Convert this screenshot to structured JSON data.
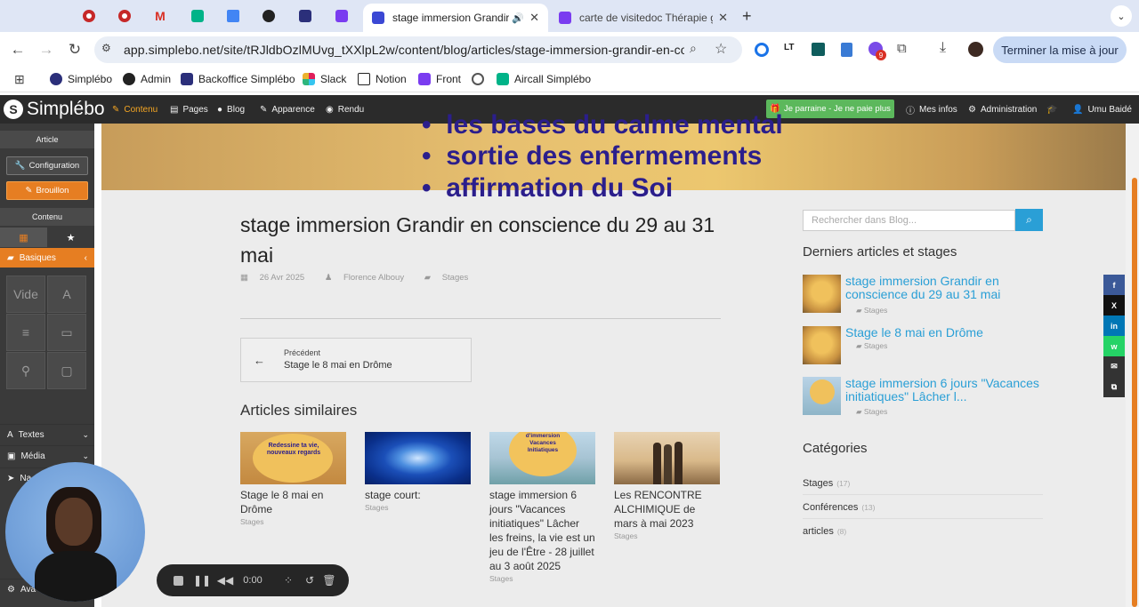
{
  "browser": {
    "tabs": [
      {
        "label": "stage immersion Grandir e",
        "active": true,
        "icon": "simplebo-tab-icon",
        "color": "#3b48d4"
      },
      {
        "label": "carte de visitedoc Thérapie g",
        "active": false,
        "icon": "form-tab-icon",
        "color": "#7a3cf0"
      }
    ],
    "url": "app.simplebo.net/site/tRJldbOzlMUvg_tXXlpL2w/content/blog/articles/stage-immersion-grandir-en-cons...",
    "update_button": "Terminer la mise à jour",
    "extension_badge": "9"
  },
  "bookmarks": [
    {
      "label": "Simplébo",
      "icon": "simplebo-icon"
    },
    {
      "label": "Admin",
      "icon": "admin-icon"
    },
    {
      "label": "Backoffice Simplébo",
      "icon": "backoffice-icon"
    },
    {
      "label": "Slack",
      "icon": "slack-icon"
    },
    {
      "label": "Notion",
      "icon": "notion-icon"
    },
    {
      "label": "Front",
      "icon": "front-icon"
    },
    {
      "label": "",
      "icon": "globe-icon"
    },
    {
      "label": "Aircall Simplébo",
      "icon": "aircall-icon"
    }
  ],
  "toolbar": {
    "logo": "Simplébo",
    "items": [
      "Contenu",
      "Pages",
      "Blog",
      "Apparence",
      "Rendu"
    ],
    "parrain": "Je parraine - Je ne paie plus",
    "right": [
      "Mes infos",
      "Administration",
      "Umu Baidé"
    ]
  },
  "leftpanel": {
    "article_header": "Article",
    "config_button": "Configuration",
    "draft_button": "Brouillon",
    "content_header": "Contenu",
    "basiques": "Basiques",
    "vide": "Vide",
    "textes": "Textes",
    "media": "Média",
    "truncated_rows": [
      "Na",
      "Ava"
    ]
  },
  "hero": {
    "lines": [
      "les bases du calme mental",
      "sortie des enfermements",
      "affirmation du Soi"
    ]
  },
  "post": {
    "title": "stage immersion Grandir en conscience du 29 au 31 mai",
    "date": "26 Avr 2025",
    "author": "Florence Albouy",
    "category": "Stages",
    "prev_label": "Précédent",
    "prev_title": "Stage le 8 mai en Drôme",
    "similar_heading": "Articles similaires",
    "similar": [
      {
        "title": "Stage le 8 mai en Drôme",
        "cat": "Stages",
        "thumb_text": "Redessine ta vie, nouveaux regards"
      },
      {
        "title": "stage court:",
        "cat": "Stages",
        "thumb_text": ""
      },
      {
        "title": "stage immersion 6 jours \"Vacances initiatiques\" Lâcher les freins, la vie est un jeu de l'Être - 28 juillet au 3 août 2025",
        "cat": "Stages",
        "thumb_text": "d'immersion Vacances Initiatiques"
      },
      {
        "title": "Les RENCONTRE ALCHIMIQUE de mars à mai 2023",
        "cat": "Stages",
        "thumb_text": ""
      }
    ]
  },
  "sidebar": {
    "search_placeholder": "Rechercher dans Blog...",
    "recent_heading": "Derniers articles et stages",
    "recent": [
      {
        "title": "stage immersion Grandir en conscience du 29 au 31 mai",
        "cat": "Stages"
      },
      {
        "title": "Stage le 8 mai en Drôme",
        "cat": "Stages"
      },
      {
        "title": "stage immersion 6 jours \"Vacances initiatiques\" Lâcher l...",
        "cat": "Stages"
      }
    ],
    "categories_heading": "Catégories",
    "categories": [
      {
        "name": "Stages",
        "count": "(17)"
      },
      {
        "name": "Conférences",
        "count": "(13)"
      },
      {
        "name": "articles",
        "count": "(8)"
      }
    ]
  },
  "share": [
    "f",
    "X",
    "in",
    "w",
    "✉",
    "⧉"
  ],
  "recorder": {
    "time": "0:00"
  },
  "colors": {
    "accent": "#e67e22",
    "link": "#2a9fd6",
    "green": "#5cb85c"
  }
}
